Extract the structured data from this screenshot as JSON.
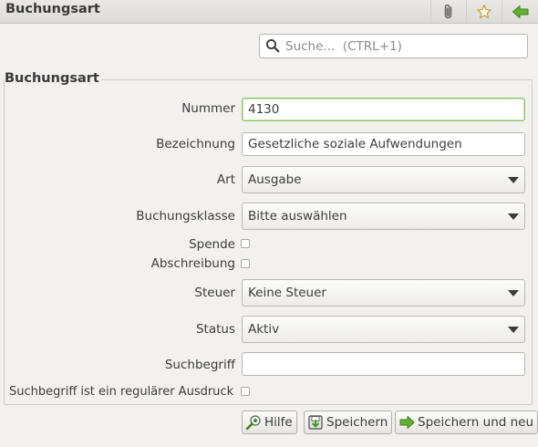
{
  "window": {
    "title": "Buchungsart",
    "toolbar_icons": [
      "paperclip-icon",
      "star-icon",
      "back-arrow-icon"
    ]
  },
  "search": {
    "placeholder": "Suche...  (CTRL+1)",
    "value": ""
  },
  "group": {
    "title": "Buchungsart"
  },
  "form": {
    "nummer": {
      "label": "Nummer",
      "value": "4130"
    },
    "bezeichnung": {
      "label": "Bezeichnung",
      "value": "Gesetzliche soziale Aufwendungen"
    },
    "art": {
      "label": "Art",
      "value": "Ausgabe"
    },
    "buchungsklasse": {
      "label": "Buchungsklasse",
      "value": "Bitte auswählen"
    },
    "spende": {
      "label": "Spende",
      "checked": false
    },
    "abschreibung": {
      "label": "Abschreibung",
      "checked": false
    },
    "steuer": {
      "label": "Steuer",
      "value": "Keine Steuer"
    },
    "status": {
      "label": "Status",
      "value": "Aktiv"
    },
    "suchbegriff": {
      "label": "Suchbegriff",
      "value": ""
    },
    "regex": {
      "label": "Suchbegriff ist ein regulärer Ausdruck",
      "checked": false
    }
  },
  "buttons": {
    "help": "Hilfe",
    "save": "Speichern",
    "save_new": "Speichern und neu"
  },
  "colors": {
    "focus_border": "#8fc364",
    "accent_green": "#3f9a1e"
  }
}
